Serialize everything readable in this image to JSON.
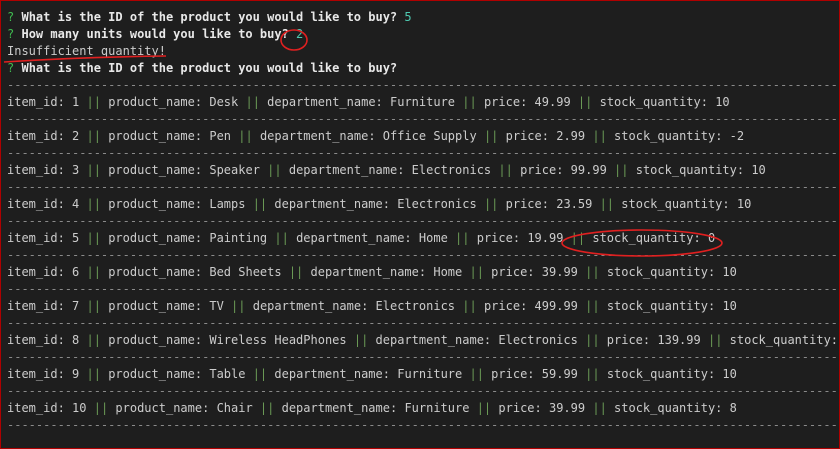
{
  "terminal": {
    "prompt_mark": "?",
    "q1": "What is the ID of the product you would like to buy?",
    "a1": "5",
    "q2": "How many units would you like to buy?",
    "a2": "2",
    "error": "Insufficient quantity!",
    "q3": "What is the ID of the product you would like to buy?",
    "separator": "--------------------------------------------------------------------------------------------------------------------------------",
    "pipe": "||"
  },
  "labels": {
    "item_id": "item_id:",
    "product_name": "product_name:",
    "department_name": "department_name:",
    "price": "price:",
    "stock_quantity": "stock_quantity:"
  },
  "products": [
    {
      "item_id": "1",
      "product_name": "Desk",
      "department_name": "Furniture",
      "price": "49.99",
      "stock_quantity": "10"
    },
    {
      "item_id": "2",
      "product_name": "Pen",
      "department_name": "Office Supply",
      "price": "2.99",
      "stock_quantity": "-2"
    },
    {
      "item_id": "3",
      "product_name": "Speaker",
      "department_name": "Electronics",
      "price": "99.99",
      "stock_quantity": "10"
    },
    {
      "item_id": "4",
      "product_name": "Lamps",
      "department_name": "Electronics",
      "price": "23.59",
      "stock_quantity": "10"
    },
    {
      "item_id": "5",
      "product_name": "Painting",
      "department_name": "Home",
      "price": "19.99",
      "stock_quantity": "0"
    },
    {
      "item_id": "6",
      "product_name": "Bed Sheets",
      "department_name": "Home",
      "price": "39.99",
      "stock_quantity": "10"
    },
    {
      "item_id": "7",
      "product_name": "TV",
      "department_name": "Electronics",
      "price": "499.99",
      "stock_quantity": "10"
    },
    {
      "item_id": "8",
      "product_name": "Wireless HeadPhones",
      "department_name": "Electronics",
      "price": "139.99",
      "stock_quantity": "5"
    },
    {
      "item_id": "9",
      "product_name": "Table",
      "department_name": "Furniture",
      "price": "59.99",
      "stock_quantity": "10"
    },
    {
      "item_id": "10",
      "product_name": "Chair",
      "department_name": "Furniture",
      "price": "39.99",
      "stock_quantity": "8"
    }
  ],
  "colors": {
    "background": "#1e1e1e",
    "prompt_mark": "#3fb950",
    "answer": "#4ec9b0",
    "pipe": "#6a9955",
    "annotation": "#e02020"
  }
}
